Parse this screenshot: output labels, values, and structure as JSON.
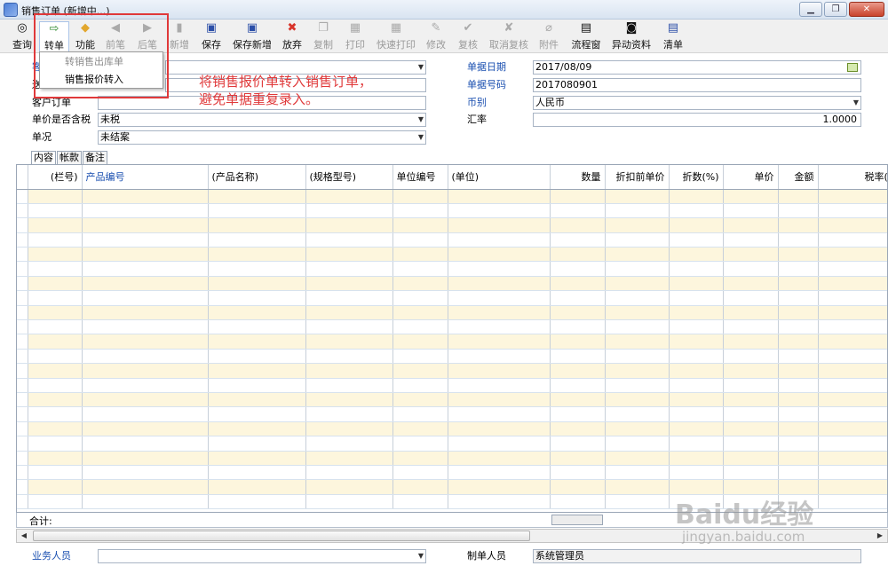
{
  "window": {
    "title": "销售订单 (新增中...)",
    "minimize": "▁",
    "restore": "❐",
    "close": "✕"
  },
  "toolbar": [
    {
      "id": "query",
      "label": "查询",
      "icon": "◎",
      "disabled": false
    },
    {
      "id": "transfer",
      "label": "转单",
      "icon": "⇨",
      "disabled": false
    },
    {
      "id": "function",
      "label": "功能",
      "icon": "◆",
      "disabled": false
    },
    {
      "id": "prev",
      "label": "前笔",
      "icon": "◀",
      "disabled": true
    },
    {
      "id": "next",
      "label": "后笔",
      "icon": "▶",
      "disabled": true
    },
    {
      "id": "new",
      "label": "新增",
      "icon": "▮",
      "disabled": true
    },
    {
      "id": "save",
      "label": "保存",
      "icon": "▣",
      "disabled": false
    },
    {
      "id": "save-new",
      "label": "保存新增",
      "icon": "▣",
      "disabled": false
    },
    {
      "id": "discard",
      "label": "放弃",
      "icon": "✖",
      "disabled": false
    },
    {
      "id": "copy",
      "label": "复制",
      "icon": "❐",
      "disabled": true
    },
    {
      "id": "print",
      "label": "打印",
      "icon": "▦",
      "disabled": true
    },
    {
      "id": "quick-print",
      "label": "快速打印",
      "icon": "▦",
      "disabled": true
    },
    {
      "id": "edit",
      "label": "修改",
      "icon": "✎",
      "disabled": true
    },
    {
      "id": "review",
      "label": "复核",
      "icon": "✔",
      "disabled": true
    },
    {
      "id": "cancel-review",
      "label": "取消复核",
      "icon": "✘",
      "disabled": true
    },
    {
      "id": "attachment",
      "label": "附件",
      "icon": "⌀",
      "disabled": true
    },
    {
      "id": "flow",
      "label": "流程窗",
      "icon": "▤",
      "disabled": false
    },
    {
      "id": "change-data",
      "label": "异动资料",
      "icon": "◙",
      "disabled": false
    },
    {
      "id": "clear",
      "label": "清单",
      "icon": "▤",
      "disabled": false
    }
  ],
  "dropdown": {
    "items": [
      {
        "label": "转销售出库单",
        "disabled": true
      },
      {
        "label": "销售报价转入",
        "disabled": false
      }
    ]
  },
  "annotation": {
    "line1": "将销售报价单转入销售订单，",
    "line2": "避免单据重复录入。"
  },
  "form": {
    "row1_label": "客",
    "row2_label": "送",
    "customer_order_label": "客户订单",
    "tax_included_label": "单价是否含税",
    "tax_included_value": "未税",
    "status_label": "单况",
    "status_value": "未结案",
    "doc_date_label": "单据日期",
    "doc_date_value": "2017/08/09",
    "doc_no_label": "单据号码",
    "doc_no_value": "2017080901",
    "currency_label": "币别",
    "currency_value": "人民币",
    "rate_label": "汇率",
    "rate_value": "1.0000"
  },
  "tabs": [
    "内容",
    "帐款",
    "备注"
  ],
  "grid": {
    "columns": [
      "(栏号)",
      "产品编号",
      "(产品名称)",
      "(规格型号)",
      "单位编号",
      "(单位)",
      "数量",
      "折扣前单价",
      "折数(%)",
      "单价",
      "金额",
      "税率(%)"
    ]
  },
  "summary": {
    "label": "合计:"
  },
  "footer": {
    "sales_person_label": "业务人员",
    "creator_label": "制单人员",
    "creator_value": "系统管理员"
  },
  "watermark": {
    "brand": "Baidu经验",
    "url": "jingyan.baidu.com"
  },
  "colors": {
    "accent_red": "#e0393a",
    "row_stripe": "#fdf6dd",
    "link_blue": "#1a4fb0"
  }
}
